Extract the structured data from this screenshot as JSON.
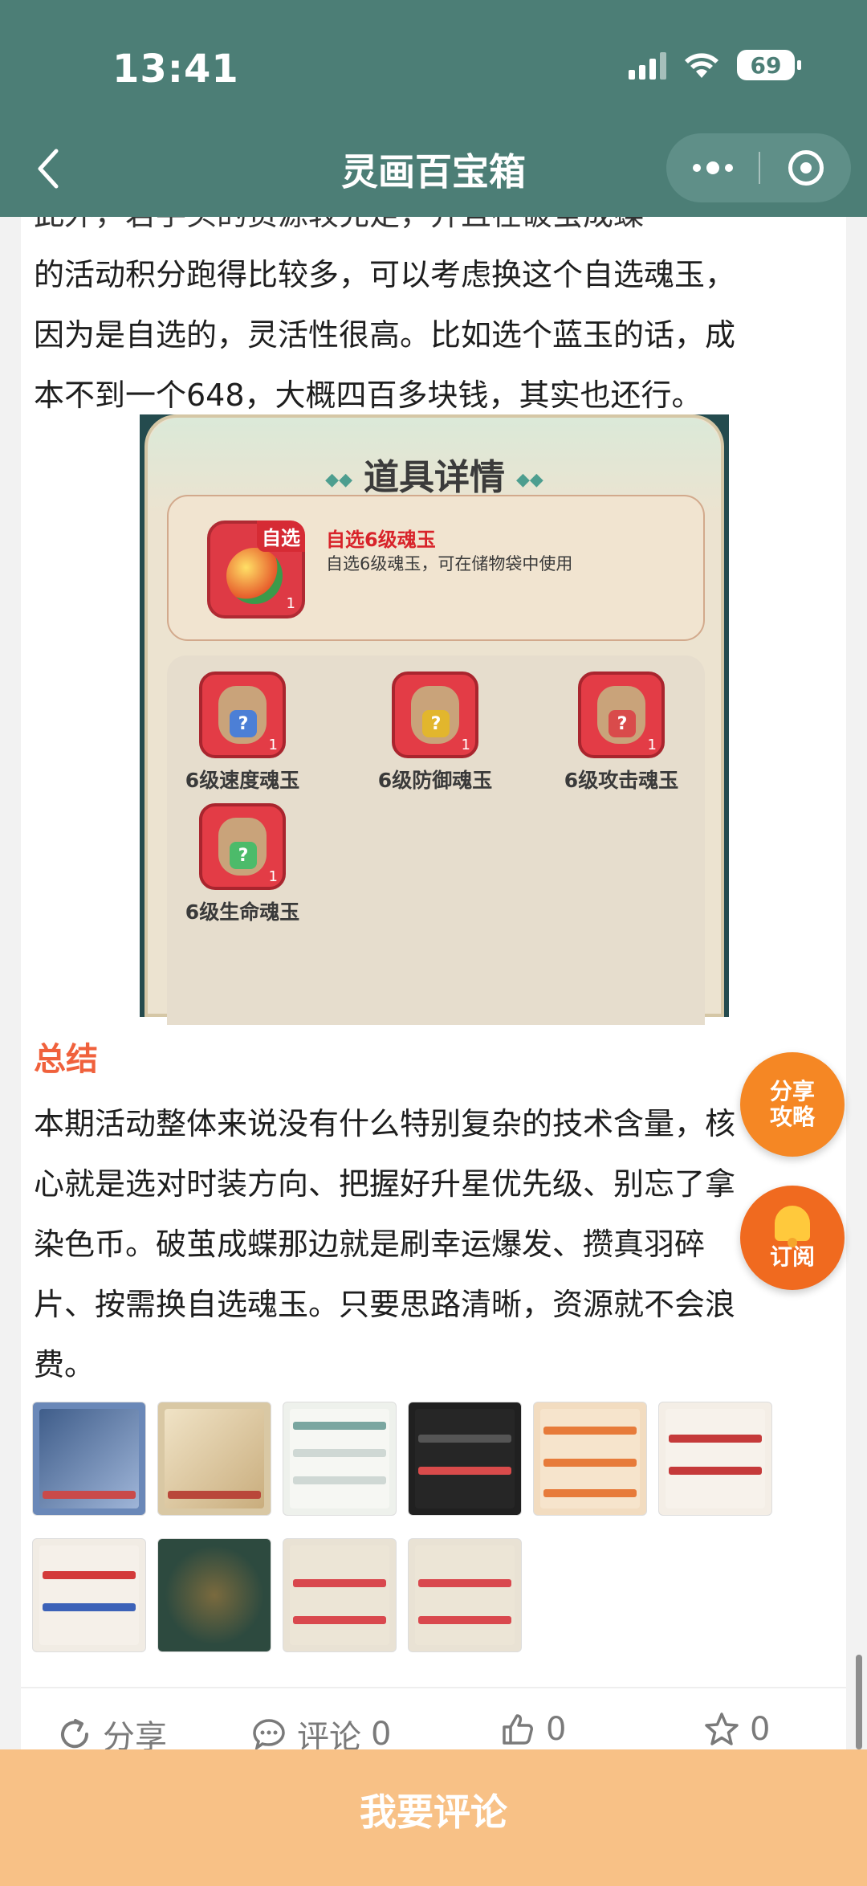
{
  "status_bar": {
    "time": "13:41",
    "battery": "69"
  },
  "nav": {
    "title": "灵画百宝箱"
  },
  "article": {
    "paragraph_top_lines": [
      "此外，若手头的资源较充足，并且在破茧成蝶",
      "的活动积分跑得比较多，可以考虑换这个自选魂玉，",
      "因为是自选的，灵活性很高。比如选个蓝玉的话，成",
      "本不到一个648，大概四百多块钱，其实也还行。"
    ],
    "item_card": {
      "title": "道具详情",
      "item_tag": "自选",
      "item_name": "自选6级魂玉",
      "item_desc": "自选6级魂玉，可在储物袋中使用",
      "item_count": "1",
      "choices": [
        {
          "label": "6级速度魂玉",
          "count": "1",
          "color": "#4c7fd6"
        },
        {
          "label": "6级防御魂玉",
          "count": "1",
          "color": "#e2b62d"
        },
        {
          "label": "6级攻击魂玉",
          "count": "1",
          "color": "#d94b4b"
        },
        {
          "label": "6级生命魂玉",
          "count": "1",
          "color": "#4cbb6a"
        }
      ]
    },
    "summary_heading": "总结",
    "summary_lines": [
      "本期活动整体来说没有什么特别复杂的技术含量，核",
      "心就是选对时装方向、把握好升星优先级、别忘了拿",
      "染色币。破茧成蝶那边就是刷幸运爆发、攒真羽碎",
      "片、按需换自选魂玉。只要思路清晰，资源就不会浪",
      "费。"
    ]
  },
  "thumbnails": [
    {
      "name": "thumb-1",
      "bg": "#6a88b8",
      "accent": "#c94a4a"
    },
    {
      "name": "thumb-2",
      "bg": "#d9c8a4",
      "accent": "#b9473a"
    },
    {
      "name": "thumb-3",
      "bg": "#eef1ec",
      "accent": "#7aa6a0"
    },
    {
      "name": "thumb-4",
      "bg": "#202020",
      "accent": "#d94b4b"
    },
    {
      "name": "thumb-5",
      "bg": "#f2dcc0",
      "accent": "#e77b3a"
    },
    {
      "name": "thumb-6",
      "bg": "#f4eee6",
      "accent": "#c53a3a"
    },
    {
      "name": "thumb-7",
      "bg": "#f1ece4",
      "accent": "#d33a3a"
    },
    {
      "name": "thumb-8",
      "bg": "#2d4a3f",
      "accent": "#c9a35c"
    },
    {
      "name": "thumb-9",
      "bg": "#e9e2d4",
      "accent": "#d9484e"
    },
    {
      "name": "thumb-10",
      "bg": "#e9e2d4",
      "accent": "#d9484e"
    }
  ],
  "actions": {
    "share": "分享",
    "comment": "评论",
    "comment_count": "0",
    "like_count": "0",
    "favorite_count": "0"
  },
  "floating": {
    "share_line1": "分享",
    "share_line2": "攻略",
    "subscribe": "订阅"
  },
  "bottom": {
    "comment_button": "我要评论"
  },
  "colors": {
    "header": "#4c7e76",
    "accent": "#f0613c",
    "bottom_bar": "#f8c186"
  }
}
